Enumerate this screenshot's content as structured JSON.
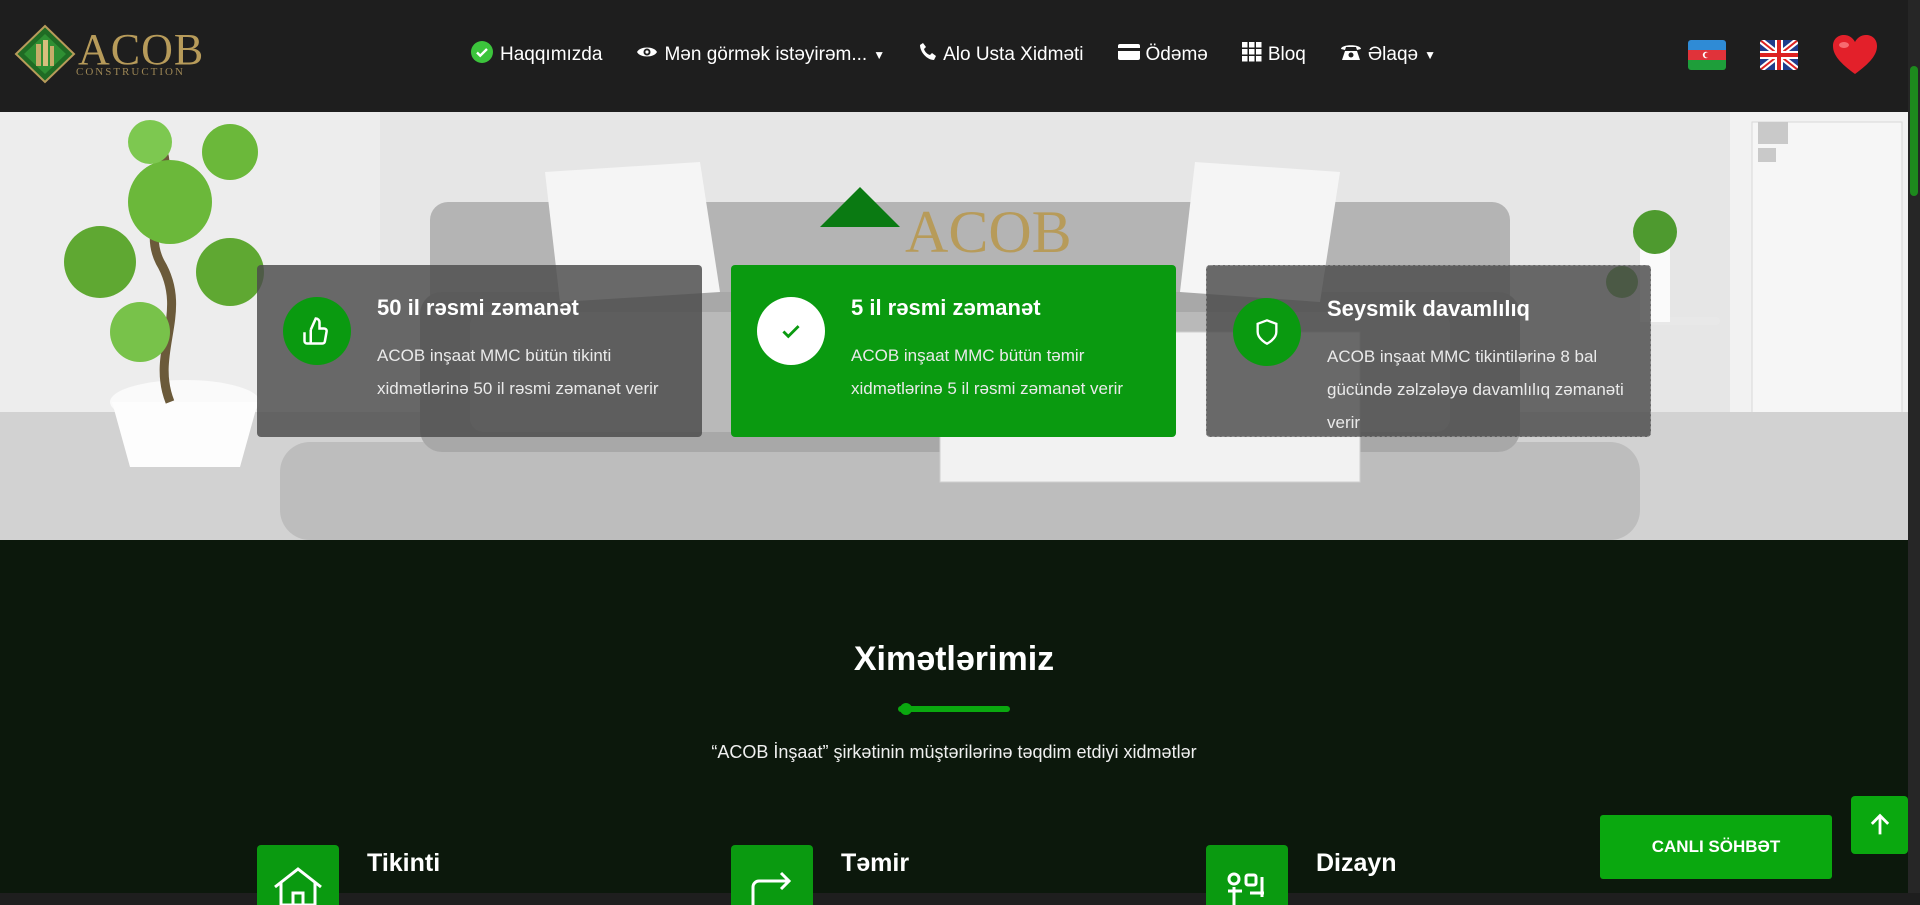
{
  "logo": {
    "text": "ACOB",
    "subtext": "CONSTRUCTION"
  },
  "nav": {
    "about": "Haqqımızda",
    "wish": "Mən görmək istəyirəm...",
    "alo": "Alo Usta Xidməti",
    "payment": "Ödəmə",
    "blog": "Bloq",
    "contact": "Əlaqə"
  },
  "hero_brand": "ACOB",
  "features": [
    {
      "title": "50 il rəsmi zəmanət",
      "desc": "ACOB inşaat MMC bütün tikinti xidmətlərinə 50 il rəsmi zəmanət verir",
      "icon": "thumbs-up-icon"
    },
    {
      "title": "5 il rəsmi zəmanət",
      "desc": "ACOB inşaat MMC bütün təmir xidmətlərinə 5 il rəsmi zəmanət verir",
      "icon": "check-icon"
    },
    {
      "title": "Seysmik davamlılıq",
      "desc": "ACOB inşaat MMC tikintilərinə 8 bal gücündə zəlzələyə davamlılıq zəmanəti verir",
      "icon": "shield-icon"
    }
  ],
  "services": {
    "title": "Ximətlərimiz",
    "subtitle": "“ACOB İnşaat” şirkətinin müştərilərinə təqdim etdiyi xidmətlər",
    "items": [
      {
        "name": "Tikinti",
        "icon": "house-icon"
      },
      {
        "name": "Təmir",
        "icon": "redo-arrow-icon"
      },
      {
        "name": "Dizayn",
        "icon": "design-tools-icon"
      }
    ]
  },
  "chat_label": "CANLI SÖHBƏT",
  "colors": {
    "accent": "#0a9a10",
    "header_bg": "#1e1e1e",
    "section_bg": "#0c180c"
  }
}
